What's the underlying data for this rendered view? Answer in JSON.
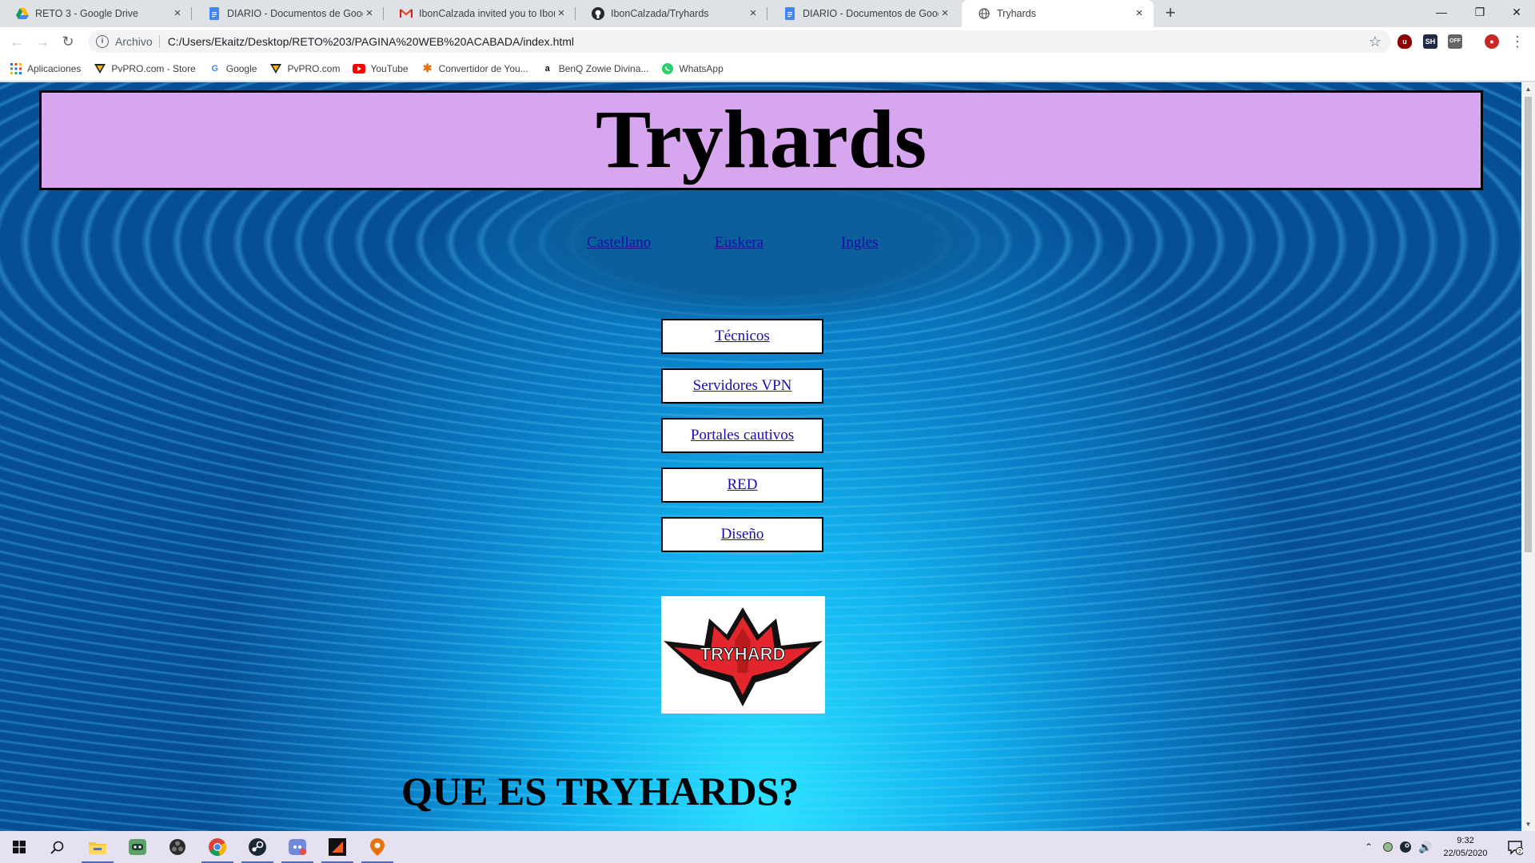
{
  "browser": {
    "tabs": [
      {
        "title": "RETO 3 - Google Drive",
        "icon": "google-drive-icon"
      },
      {
        "title": "DIARIO - Documentos de Google",
        "icon": "google-docs-icon"
      },
      {
        "title": "IbonCalzada invited you to IbonC",
        "icon": "gmail-icon"
      },
      {
        "title": "IbonCalzada/Tryhards",
        "icon": "github-icon"
      },
      {
        "title": "DIARIO - Documentos de Google",
        "icon": "google-docs-icon"
      },
      {
        "title": "Tryhards",
        "icon": "globe-icon",
        "active": true
      }
    ],
    "omnibox": {
      "chip": "Archivo",
      "url": "C:/Users/Ekaitz/Desktop/RETO%203/PAGINA%20WEB%20ACABADA/index.html"
    },
    "bookmarks": [
      {
        "label": "Aplicaciones",
        "icon": "apps-grid-icon"
      },
      {
        "label": "PvPRO.com - Store",
        "icon": "pvpro-icon"
      },
      {
        "label": "Google",
        "icon": "google-icon"
      },
      {
        "label": "PvPRO.com",
        "icon": "pvpro-icon"
      },
      {
        "label": "YouTube",
        "icon": "youtube-icon"
      },
      {
        "label": "Convertidor de You...",
        "icon": "converter-icon"
      },
      {
        "label": "BenQ Zowie Divina...",
        "icon": "amazon-icon"
      },
      {
        "label": "WhatsApp",
        "icon": "whatsapp-icon"
      }
    ],
    "extensions": [
      "ublock-icon",
      "sh-extension-icon",
      "off-extension-icon",
      "profile-avatar-icon"
    ]
  },
  "page": {
    "title": "Tryhards",
    "languages": [
      "Castellano",
      "Euskera",
      "Ingles"
    ],
    "nav": [
      "Técnicos",
      "Servidores VPN",
      "Portales cautivos",
      "RED",
      "Diseño"
    ],
    "logo_text": "TRYHARD",
    "section_title": "QUE ES TRYHARDS?"
  },
  "taskbar": {
    "apps": [
      "windows-start-icon",
      "search-icon",
      "file-explorer-icon",
      "game-launcher-icon",
      "obs-icon",
      "chrome-icon",
      "steam-icon",
      "discord-icon",
      "app-launcher-icon",
      "maps-icon"
    ],
    "clock": {
      "time": "9:32",
      "date": "22/05/2020"
    },
    "notifications": "2"
  },
  "colors": {
    "header_bg": "#d8a6ef",
    "link": "#1a0dab",
    "bg_deep": "#064f95",
    "bg_bright": "#2be3ff"
  }
}
